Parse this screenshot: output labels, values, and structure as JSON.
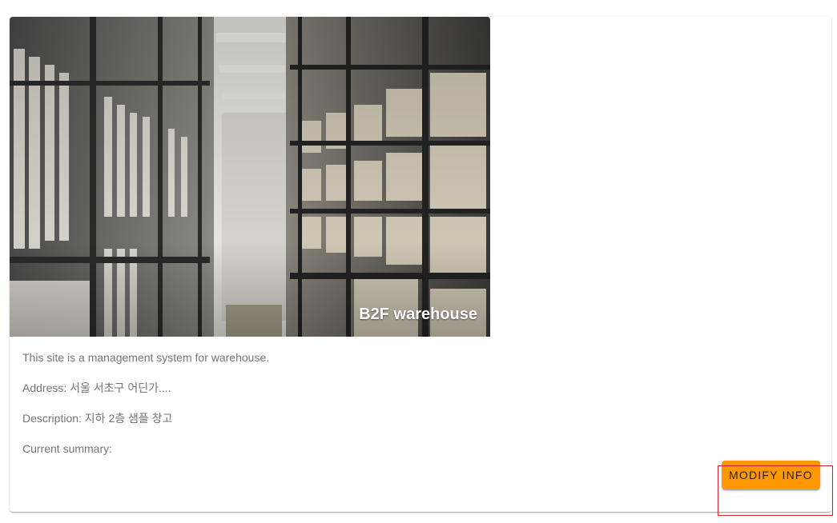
{
  "card": {
    "image_title": "B2F warehouse",
    "intro": "This site is a management system for warehouse.",
    "address": "Address: 서울 서초구 어딘가....",
    "description": "Description: 지하 2층 샘플 창고",
    "summary": "Current summary:"
  },
  "actions": {
    "modify_label": "MODIFY INFO"
  },
  "colors": {
    "accent": "#ff9800",
    "highlight": "#d0202e",
    "body_text": "#757575"
  }
}
